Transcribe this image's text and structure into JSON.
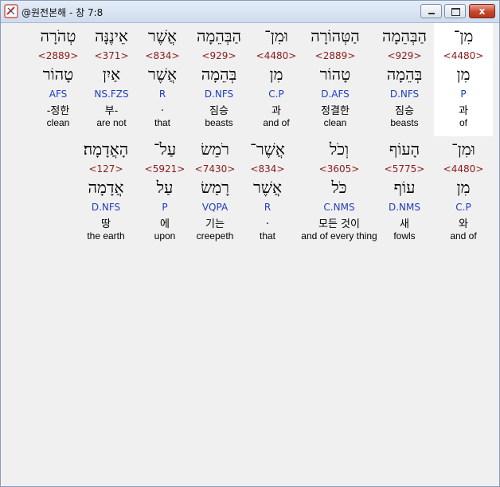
{
  "window": {
    "title": "@원전본해 - 창 7:8",
    "buttons": {
      "minimize": "",
      "maximize": "",
      "close": "x"
    }
  },
  "rows": [
    {
      "words": [
        {
          "heb1": "מִן־",
          "strong": "<4480>",
          "heb2": "מִן",
          "morph": "P",
          "kor": "과",
          "eng": "of",
          "selected": true
        },
        {
          "heb1": "הַבְּהֵמָה",
          "strong": "<929>",
          "heb2": "בְּהֵמָה",
          "morph": "D.NFS",
          "kor": "짐승",
          "eng": "beasts"
        },
        {
          "heb1": "הַטְּהוֹרָה",
          "strong": "<2889>",
          "heb2": "טָהוֹר",
          "morph": "D.AFS",
          "kor": "정결한",
          "eng": "clean"
        },
        {
          "heb1": "וּמִן־",
          "strong": "<4480>",
          "heb2": "מִן",
          "morph": "C.P",
          "kor": "과",
          "eng": "and of"
        },
        {
          "heb1": "הַבְּהֵמָה",
          "strong": "<929>",
          "heb2": "בְּהֵמָה",
          "morph": "D.NFS",
          "kor": "짐승",
          "eng": "beasts"
        },
        {
          "heb1": "אֲשֶׁר",
          "strong": "<834>",
          "heb2": "אֲשֶׁר",
          "morph": "R",
          "kor": ".",
          "eng": "that"
        },
        {
          "heb1": "אֵינֶנָּה",
          "strong": "<371>",
          "heb2": "אַיִן",
          "morph": "NS.FZS",
          "kor": "부-",
          "eng": "are not"
        },
        {
          "heb1": "טְהֹרָה",
          "strong": "<2889>",
          "heb2": "טָהוֹר",
          "morph": "AFS",
          "kor": "-정한",
          "eng": "clean"
        }
      ]
    },
    {
      "words": [
        {
          "heb1": "וּמִן־",
          "strong": "<4480>",
          "heb2": "מִן",
          "morph": "C.P",
          "kor": "와",
          "eng": "and of"
        },
        {
          "heb1": "הָעוֹף",
          "strong": "<5775>",
          "heb2": "עוֹף",
          "morph": "D.NMS",
          "kor": "새",
          "eng": "fowls"
        },
        {
          "heb1": "וְכֹל",
          "strong": "<3605>",
          "heb2": "כֹּל",
          "morph": "C.NMS",
          "kor": "모든 것이",
          "eng": "and of every thing"
        },
        {
          "heb1": "אֲשֶׁר־",
          "strong": "<834>",
          "heb2": "אֲשֶׁר",
          "morph": "R",
          "kor": ".",
          "eng": "that"
        },
        {
          "heb1": "רֹמֵשׂ",
          "strong": "<7430>",
          "heb2": "רָמַשׂ",
          "morph": "VQPA",
          "kor": "기는",
          "eng": "creepeth"
        },
        {
          "heb1": "עַל־",
          "strong": "<5921>",
          "heb2": "עַל",
          "morph": "P",
          "kor": "에",
          "eng": "upon"
        },
        {
          "heb1": "הָאֲדָמָה׃",
          "strong": "<127>",
          "heb2": "אֲדָמָה",
          "morph": "D.NFS",
          "kor": "땅",
          "eng": "the earth"
        }
      ]
    }
  ]
}
